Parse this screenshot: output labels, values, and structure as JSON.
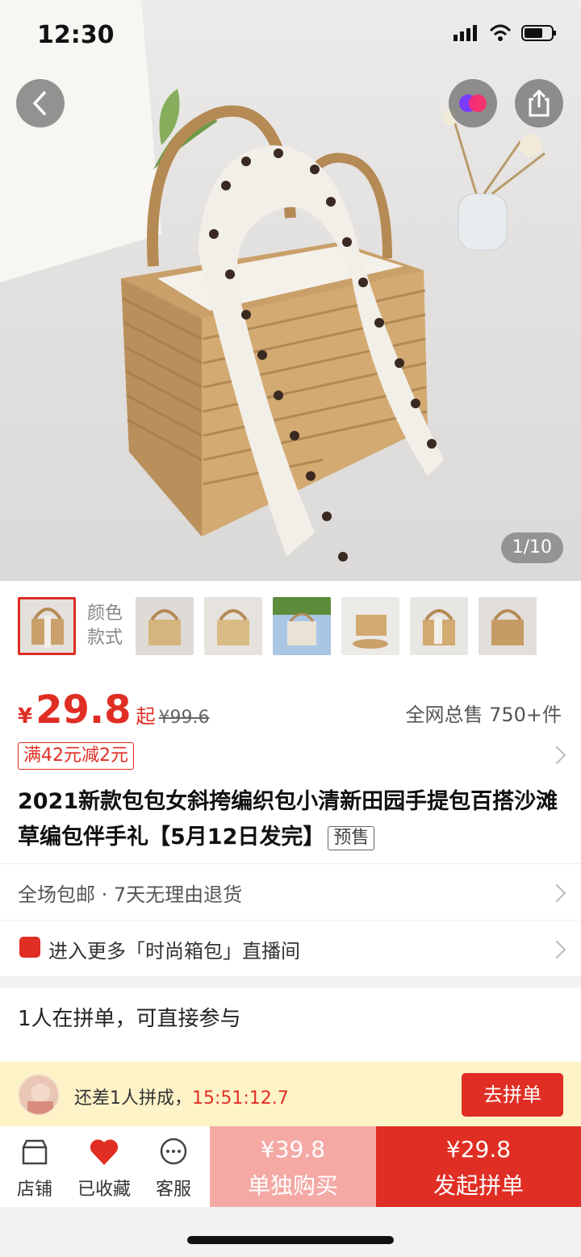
{
  "status_bar": {
    "time": "12:30"
  },
  "hero": {
    "image_counter": "1/10"
  },
  "thumb_strip": {
    "label_line1": "颜色",
    "label_line2": "款式"
  },
  "price": {
    "currency": "¥",
    "value": "29.8",
    "suffix": "起",
    "original": "¥99.6",
    "sold": "全网总售 750+件",
    "coupon": "满42元减2元"
  },
  "product": {
    "title": "2021新款包包女斜挎编织包小清新田园手提包百搭沙滩草编包伴手礼【5月12日发完】",
    "tag": "预售"
  },
  "service": {
    "text": "全场包邮 · 7天无理由退货"
  },
  "live": {
    "text": "进入更多「时尚箱包」直播间"
  },
  "group": {
    "title": "1人在拼单，可直接参与",
    "msg": "还差1人拼成，",
    "timer": "15:51:12.7",
    "join_label": "去拼单"
  },
  "bottom_bar": {
    "store_label": "店铺",
    "fav_label": "已收藏",
    "service_label": "客服",
    "solo_price": "¥39.8",
    "solo_label": "单独购买",
    "group_price": "¥29.8",
    "group_label": "发起拼单"
  },
  "colors": {
    "accent": "#e02e24",
    "solo_bg": "#f4a9a5",
    "banner_bg": "#fdf3c7"
  }
}
